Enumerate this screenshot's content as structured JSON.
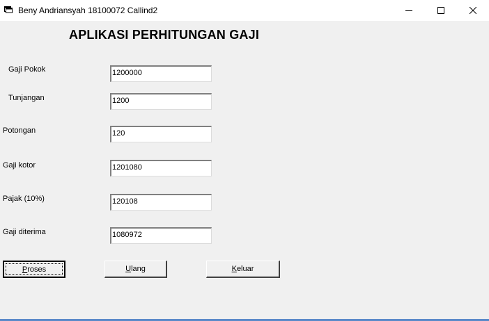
{
  "window": {
    "title": "Beny Andriansyah 18100072 Callind2",
    "icon": "app-window-icon",
    "controls": {
      "minimize": "minimize-icon",
      "maximize": "maximize-icon",
      "close": "close-icon"
    }
  },
  "form": {
    "heading": "APLIKASI PERHITUNGAN GAJI",
    "fields": [
      {
        "label": "Gaji Pokok",
        "value": "1200000"
      },
      {
        "label": "Tunjangan",
        "value": "1200"
      },
      {
        "label": "Potongan",
        "value": "120"
      },
      {
        "label": "Gaji kotor",
        "value": "1201080"
      },
      {
        "label": "Pajak (10%)",
        "value": "120108"
      },
      {
        "label": "Gaji diterima",
        "value": "1080972"
      }
    ],
    "buttons": {
      "proses": {
        "mnemonic": "P",
        "rest": "roses"
      },
      "ulang": {
        "mnemonic": "U",
        "rest": "lang"
      },
      "keluar": {
        "mnemonic": "K",
        "rest": "eluar"
      }
    }
  },
  "colors": {
    "window_bg": "#f0f0f0",
    "titlebar_bg": "#ffffff",
    "bottom_border": "#5b8ac9"
  }
}
